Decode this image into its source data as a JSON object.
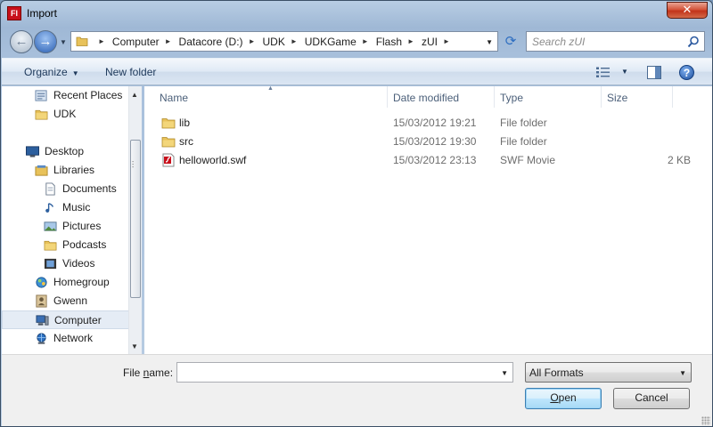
{
  "window": {
    "title": "Import",
    "app_icon_text": "Fl",
    "close_glyph": "✕"
  },
  "address_bar": {
    "crumbs": [
      "Computer",
      "Datacore (D:)",
      "UDK",
      "UDKGame",
      "Flash",
      "zUI"
    ]
  },
  "search": {
    "placeholder": "Search zUI"
  },
  "toolbar": {
    "organize_label": "Organize",
    "new_folder_label": "New folder"
  },
  "nav_pane": {
    "items": [
      {
        "label": "Recent Places",
        "icon": "recent-places-icon"
      },
      {
        "label": "UDK",
        "icon": "folder-icon"
      },
      {
        "label": "Desktop",
        "icon": "desktop-icon"
      },
      {
        "label": "Libraries",
        "icon": "libraries-icon"
      },
      {
        "label": "Documents",
        "icon": "documents-icon"
      },
      {
        "label": "Music",
        "icon": "music-icon"
      },
      {
        "label": "Pictures",
        "icon": "pictures-icon"
      },
      {
        "label": "Podcasts",
        "icon": "folder-icon"
      },
      {
        "label": "Videos",
        "icon": "videos-icon"
      },
      {
        "label": "Homegroup",
        "icon": "homegroup-icon"
      },
      {
        "label": "Gwenn",
        "icon": "user-icon"
      },
      {
        "label": "Computer",
        "icon": "computer-icon",
        "selected": true
      },
      {
        "label": "Network",
        "icon": "network-icon"
      }
    ]
  },
  "file_list": {
    "columns": [
      "Name",
      "Date modified",
      "Type",
      "Size"
    ],
    "rows": [
      {
        "name": "lib",
        "date": "15/03/2012 19:21",
        "type": "File folder",
        "size": "",
        "icon": "folder-icon"
      },
      {
        "name": "src",
        "date": "15/03/2012 19:30",
        "type": "File folder",
        "size": "",
        "icon": "folder-icon"
      },
      {
        "name": "helloworld.swf",
        "date": "15/03/2012 23:13",
        "type": "SWF Movie",
        "size": "2 KB",
        "icon": "swf-file-icon"
      }
    ]
  },
  "bottom": {
    "file_name_label_pre": "File ",
    "file_name_label_accel": "n",
    "file_name_label_post": "ame:",
    "file_name_value": "",
    "filter_value": "All Formats",
    "open_label_accel": "O",
    "open_label_rest": "pen",
    "cancel_label": "Cancel"
  },
  "colors": {
    "accent": "#3c7fb1",
    "folder": "#e8c25a",
    "selected_bg": "#e5ecf5"
  }
}
